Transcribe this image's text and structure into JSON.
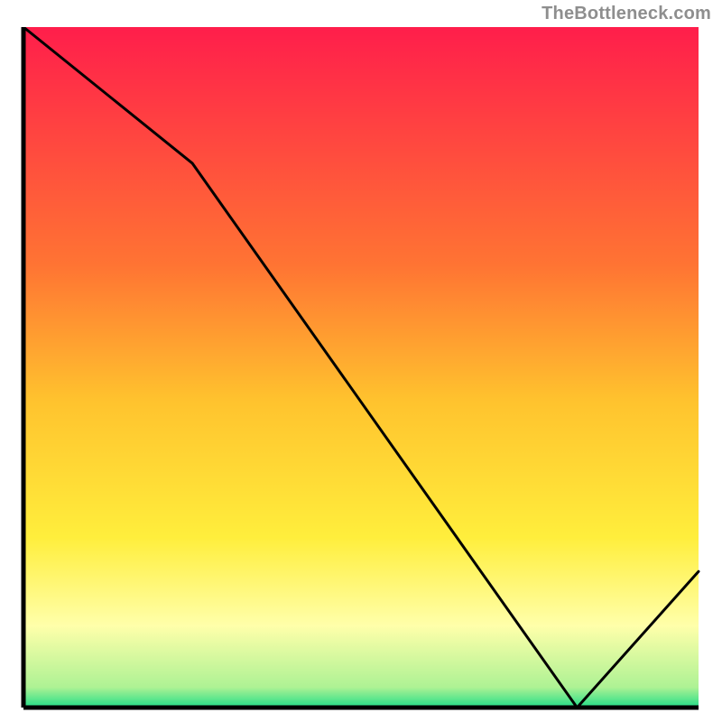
{
  "watermark": "TheBottleneck.com",
  "chart_data": {
    "type": "line",
    "title": "",
    "xlabel": "",
    "ylabel": "",
    "x": [
      0,
      25,
      82,
      100
    ],
    "values": [
      100,
      80,
      0,
      20
    ],
    "xlim": [
      0,
      100
    ],
    "ylim": [
      0,
      100
    ],
    "annotation": "",
    "annotation_x": 78,
    "gradient_stops": [
      {
        "pct": 0,
        "color": "#FF1E4B"
      },
      {
        "pct": 35,
        "color": "#FF7433"
      },
      {
        "pct": 55,
        "color": "#FFC32E"
      },
      {
        "pct": 75,
        "color": "#FFEE3C"
      },
      {
        "pct": 88,
        "color": "#FFFFAA"
      },
      {
        "pct": 97,
        "color": "#AEF294"
      },
      {
        "pct": 100,
        "color": "#22DD88"
      }
    ]
  }
}
